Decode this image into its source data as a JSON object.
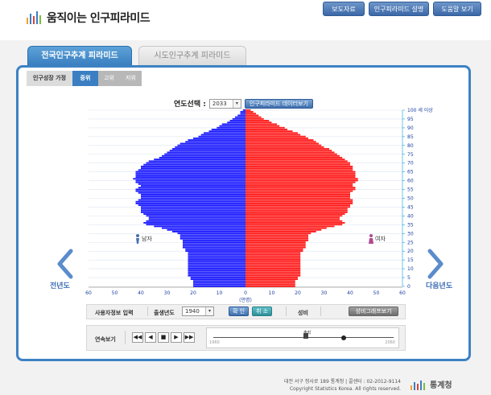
{
  "app": {
    "title": "움직이는 인구피라미드",
    "header_buttons": [
      "보도자료",
      "인구피라미드 설명",
      "도움말 보기"
    ]
  },
  "tabs": {
    "national": "전국인구추계 피라미드",
    "regional": "시도인구추계 피라미드"
  },
  "growth": {
    "label": "인구성장 가정",
    "options": [
      "중위",
      "고위",
      "저위"
    ],
    "selected": "중위"
  },
  "year_select": {
    "label": "연도선택 :",
    "value": "2033",
    "data_button": "인구피라미드 데이터보기"
  },
  "pyramid": {
    "male_label": "남자",
    "female_label": "여자",
    "x_axis_unit": "(만명)",
    "x_ticks": [
      "60",
      "50",
      "40",
      "30",
      "20",
      "10",
      "0",
      "10",
      "20",
      "30",
      "40",
      "50",
      "60"
    ],
    "age_ticks": [
      "100 세 이상",
      "95",
      "90",
      "85",
      "80",
      "75",
      "70",
      "65",
      "60",
      "55",
      "50",
      "45",
      "40",
      "35",
      "30",
      "25",
      "20",
      "15",
      "10",
      "5",
      "0"
    ],
    "male_color": "#1a1aff",
    "female_color": "#ff1a1a"
  },
  "chart_data": {
    "type": "bar",
    "xlabel": "(만명)",
    "xlim": [
      -60,
      60
    ],
    "ylim": [
      0,
      100
    ],
    "series": [
      {
        "name": "남자",
        "values": [
          20,
          20,
          20,
          20,
          21,
          21,
          22,
          22,
          22,
          22,
          22,
          22,
          22,
          22,
          22,
          22,
          22,
          22,
          22,
          22,
          23,
          23,
          24,
          24,
          24,
          24,
          24,
          25,
          25,
          25,
          26,
          28,
          30,
          32,
          35,
          38,
          39,
          38,
          37,
          37,
          38,
          39,
          40,
          40,
          40,
          40,
          41,
          42,
          42,
          41,
          40,
          40,
          40,
          41,
          42,
          42,
          41,
          40,
          41,
          42,
          42,
          43,
          42,
          42,
          42,
          42,
          41,
          40,
          40,
          39,
          38,
          37,
          35,
          33,
          32,
          31,
          30,
          29,
          28,
          27,
          26,
          25,
          23,
          22,
          20,
          18,
          17,
          16,
          14,
          13,
          11,
          10,
          9,
          7,
          6,
          5,
          4,
          3,
          2,
          2,
          1
        ]
      },
      {
        "name": "여자",
        "values": [
          19,
          19,
          19,
          19,
          20,
          20,
          21,
          21,
          21,
          21,
          21,
          21,
          21,
          21,
          21,
          21,
          21,
          21,
          21,
          21,
          22,
          22,
          23,
          23,
          23,
          23,
          24,
          24,
          24,
          24,
          25,
          27,
          29,
          31,
          34,
          37,
          38,
          37,
          36,
          36,
          37,
          38,
          39,
          39,
          39,
          40,
          40,
          41,
          41,
          41,
          40,
          40,
          40,
          40,
          41,
          42,
          42,
          41,
          41,
          42,
          43,
          43,
          42,
          42,
          42,
          42,
          41,
          41,
          41,
          40,
          40,
          39,
          38,
          37,
          36,
          35,
          34,
          33,
          32,
          30,
          29,
          28,
          27,
          26,
          24,
          23,
          21,
          20,
          18,
          16,
          15,
          13,
          12,
          10,
          9,
          7,
          6,
          5,
          4,
          3,
          2
        ]
      }
    ]
  },
  "user_info": {
    "label": "사용자정보 입력",
    "birth_year_label": "출생년도",
    "birth_year_value": "1940",
    "confirm": "확 인",
    "cancel": "취 소",
    "gender_label": "성비",
    "sex_ratio_button": "성비그래프보기"
  },
  "playback": {
    "label": "연속보기",
    "buttons": [
      "◀◀",
      "◀",
      "■",
      "▶",
      "▶▶"
    ],
    "marker_label": "출력",
    "range_start": "1960",
    "range_end": "2060"
  },
  "nav": {
    "prev_label": "전년도",
    "next_label": "다음년도"
  },
  "footer": {
    "address": "대전 서구 청사로 189 통계청 | 콜센터 : 02-2012-9114",
    "copyright": "Copyright Statistics Korea. All rights reserved.",
    "logo_text": "통계청"
  },
  "colors": {
    "accent": "#3d82c4",
    "header_button": "#4a77b4"
  }
}
